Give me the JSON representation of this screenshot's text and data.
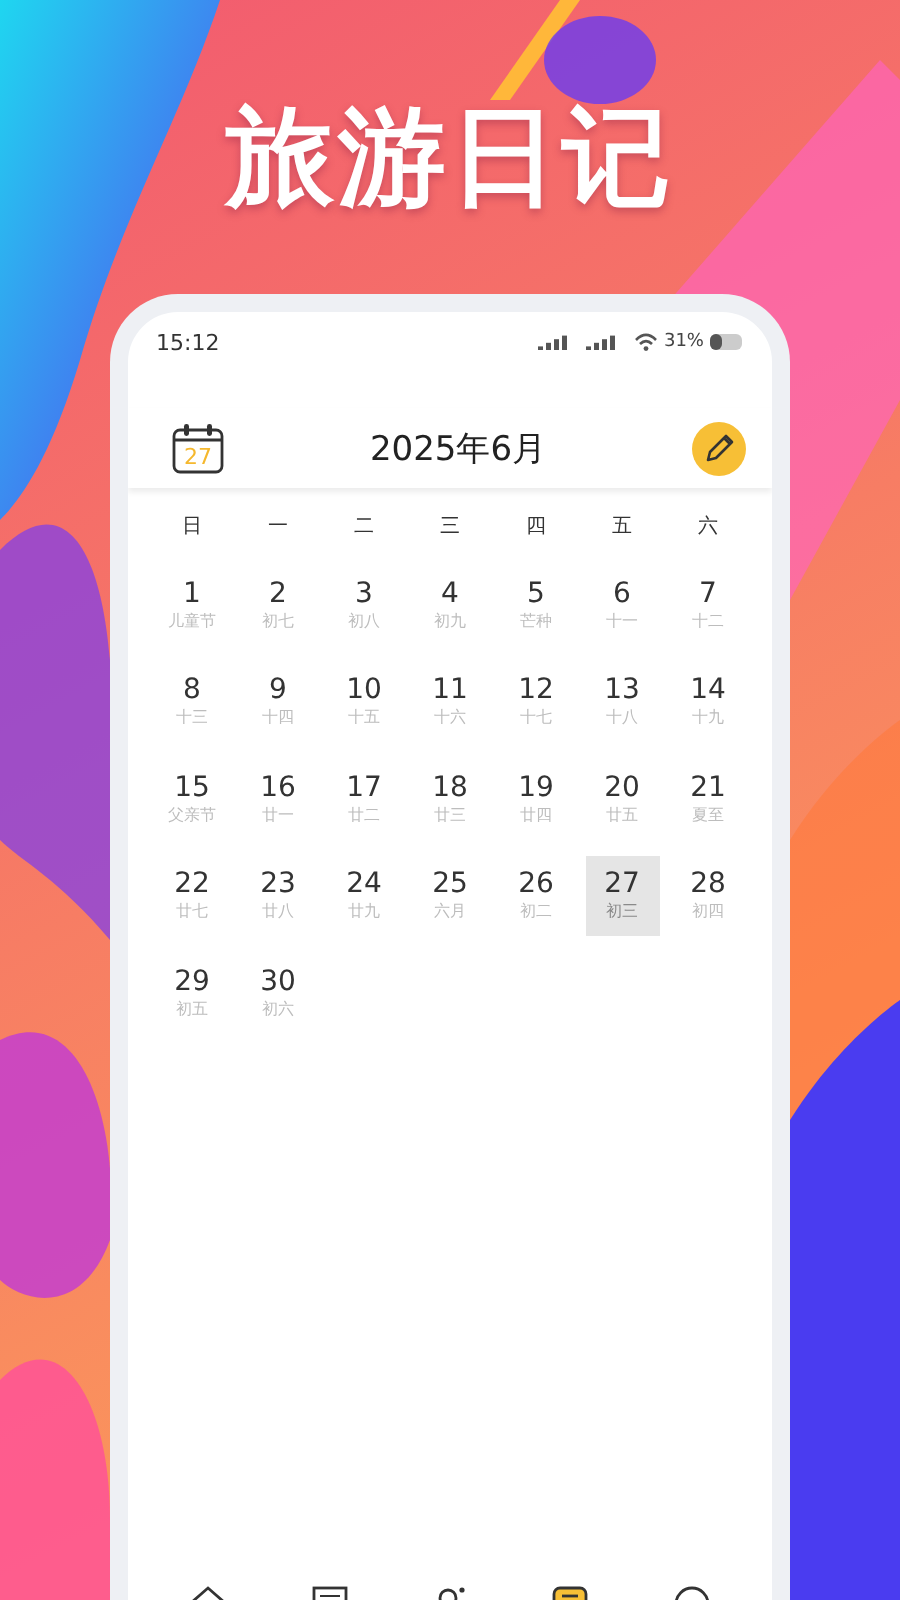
{
  "title": "旅游日记",
  "status_bar": {
    "time": "15:12",
    "battery": "31%"
  },
  "header": {
    "calendar_day": "27",
    "month": "2025年6月"
  },
  "weekdays": [
    "日",
    "一",
    "二",
    "三",
    "四",
    "五",
    "六"
  ],
  "days": [
    {
      "day": "1",
      "lunar": "儿童节",
      "selected": false
    },
    {
      "day": "2",
      "lunar": "初七",
      "selected": false
    },
    {
      "day": "3",
      "lunar": "初八",
      "selected": false
    },
    {
      "day": "4",
      "lunar": "初九",
      "selected": false
    },
    {
      "day": "5",
      "lunar": "芒种",
      "selected": false
    },
    {
      "day": "6",
      "lunar": "十一",
      "selected": false
    },
    {
      "day": "7",
      "lunar": "十二",
      "selected": false
    },
    {
      "day": "8",
      "lunar": "十三",
      "selected": false
    },
    {
      "day": "9",
      "lunar": "十四",
      "selected": false
    },
    {
      "day": "10",
      "lunar": "十五",
      "selected": false
    },
    {
      "day": "11",
      "lunar": "十六",
      "selected": false
    },
    {
      "day": "12",
      "lunar": "十七",
      "selected": false
    },
    {
      "day": "13",
      "lunar": "十八",
      "selected": false
    },
    {
      "day": "14",
      "lunar": "十九",
      "selected": false
    },
    {
      "day": "15",
      "lunar": "父亲节",
      "selected": false
    },
    {
      "day": "16",
      "lunar": "廿一",
      "selected": false
    },
    {
      "day": "17",
      "lunar": "廿二",
      "selected": false
    },
    {
      "day": "18",
      "lunar": "廿三",
      "selected": false
    },
    {
      "day": "19",
      "lunar": "廿四",
      "selected": false
    },
    {
      "day": "20",
      "lunar": "廿五",
      "selected": false
    },
    {
      "day": "21",
      "lunar": "夏至",
      "selected": false
    },
    {
      "day": "22",
      "lunar": "廿七",
      "selected": false
    },
    {
      "day": "23",
      "lunar": "廿八",
      "selected": false
    },
    {
      "day": "24",
      "lunar": "廿九",
      "selected": false
    },
    {
      "day": "25",
      "lunar": "六月",
      "selected": false
    },
    {
      "day": "26",
      "lunar": "初二",
      "selected": false
    },
    {
      "day": "27",
      "lunar": "初三",
      "selected": true
    },
    {
      "day": "28",
      "lunar": "初四",
      "selected": false
    },
    {
      "day": "29",
      "lunar": "初五",
      "selected": false
    },
    {
      "day": "30",
      "lunar": "初六",
      "selected": false
    }
  ]
}
